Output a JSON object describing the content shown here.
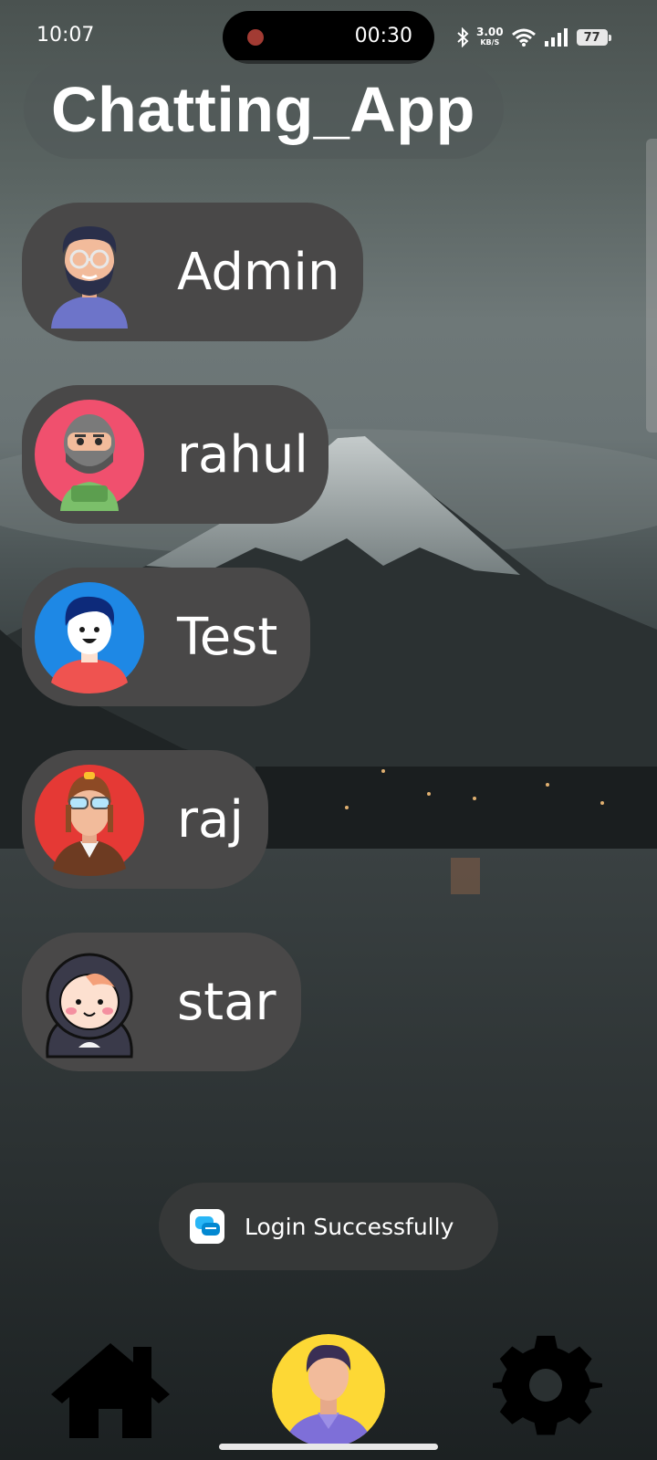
{
  "status_bar": {
    "time": "10:07",
    "recording_timer": "00:30",
    "net_speed_value": "3.00",
    "net_speed_unit": "KB/S",
    "battery": "77",
    "icons": [
      "bluetooth-icon",
      "wifi-icon",
      "signal-icon",
      "battery-icon"
    ]
  },
  "app": {
    "title": "Chatting_App"
  },
  "users": [
    {
      "name": "Admin",
      "avatar": "bearded-man-avatar",
      "avatar_bg": "none"
    },
    {
      "name": "rahul",
      "avatar": "ninja-avatar",
      "avatar_bg": "#f0506e"
    },
    {
      "name": "Test",
      "avatar": "smiling-boy-avatar",
      "avatar_bg": "#1e88e5"
    },
    {
      "name": "raj",
      "avatar": "pilot-avatar",
      "avatar_bg": "#e53935"
    },
    {
      "name": "star",
      "avatar": "hooded-kid-avatar",
      "avatar_bg": "none"
    }
  ],
  "toast": {
    "text": "Login Successfully",
    "icon": "chat-app-icon"
  },
  "bottom_nav": {
    "items": [
      "home-icon",
      "profile-avatar",
      "settings-gear-icon"
    ]
  },
  "colors": {
    "item_background": "#494848",
    "toast_background": "#363838",
    "text": "#ffffff"
  }
}
